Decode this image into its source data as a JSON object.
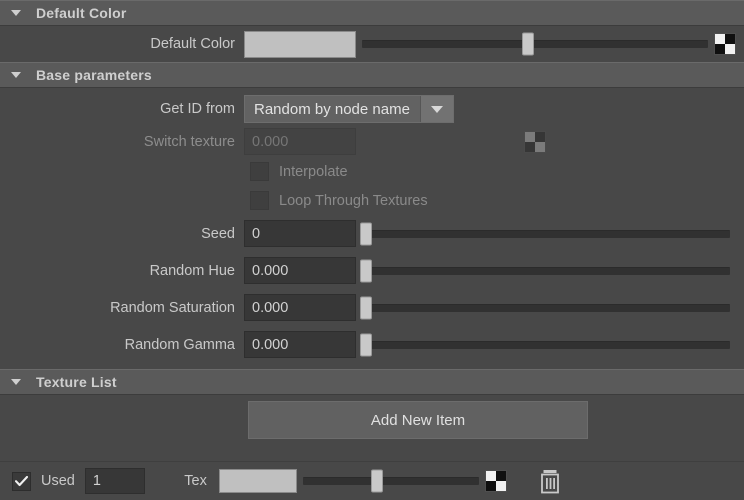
{
  "sections": {
    "default_color": {
      "title": "Default Color",
      "row": {
        "label": "Default Color",
        "swatch_color": "#c0c0c0",
        "slider_value_pct": 48,
        "texture_icon": "checker-icon"
      }
    },
    "base_parameters": {
      "title": "Base parameters",
      "get_id_from": {
        "label": "Get ID from",
        "value": "Random by node name",
        "arrow_icon": "chevron-down-icon"
      },
      "switch_texture": {
        "label": "Switch texture",
        "value": "0.000",
        "texture_icon": "checker-icon",
        "enabled": false
      },
      "interpolate": {
        "label": "Interpolate",
        "checked": false,
        "enabled": false
      },
      "loop_through_textures": {
        "label": "Loop Through Textures",
        "checked": false,
        "enabled": false
      },
      "seed": {
        "label": "Seed",
        "value": "0",
        "slider_value_pct": 0
      },
      "random_hue": {
        "label": "Random Hue",
        "value": "0.000",
        "slider_value_pct": 0
      },
      "random_saturation": {
        "label": "Random Saturation",
        "value": "0.000",
        "slider_value_pct": 0
      },
      "random_gamma": {
        "label": "Random Gamma",
        "value": "0.000",
        "slider_value_pct": 0
      }
    },
    "texture_list": {
      "title": "Texture List",
      "add_button_label": "Add New Item",
      "item": {
        "used_label": "Used",
        "used_checked": true,
        "index": "1",
        "tex_label": "Tex",
        "swatch_color": "#c0c0c0",
        "slider_value_pct": 42,
        "texture_icon": "checker-icon",
        "delete_icon": "trash-icon"
      }
    }
  },
  "colors": {
    "panel_bg": "#484848",
    "header_bg": "#5a5a5a",
    "field_bg": "#373737",
    "text": "#c9c9c9",
    "text_dim": "#8a8a8a",
    "handle": "#c9c9c9",
    "track": "#313131"
  }
}
